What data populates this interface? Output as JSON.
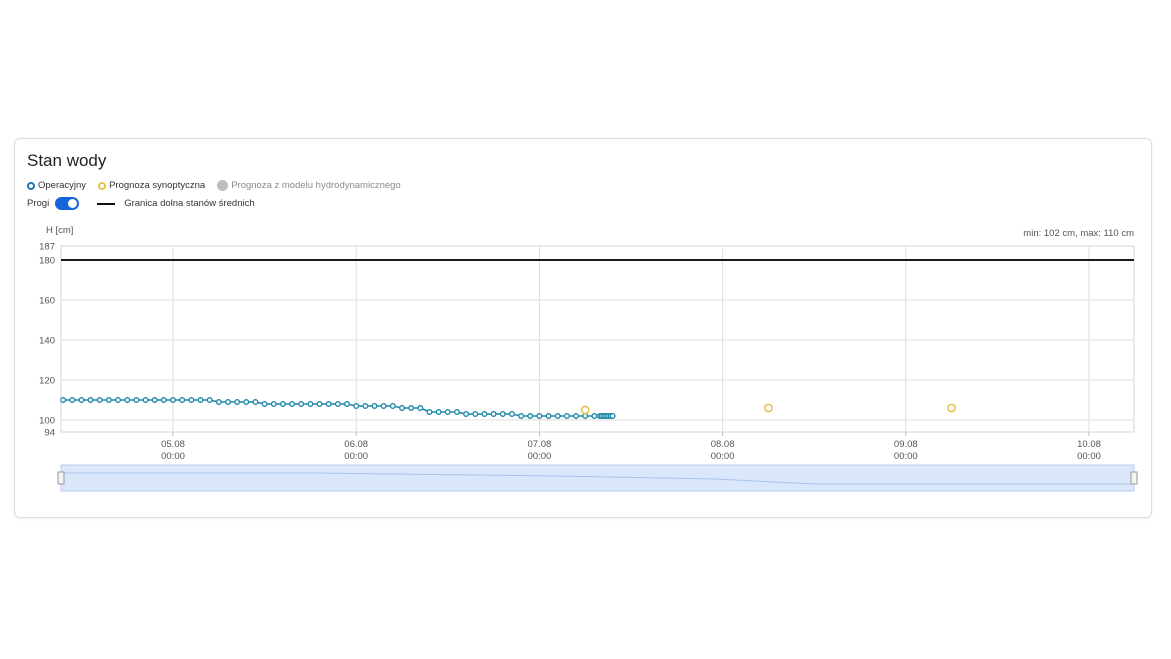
{
  "card": {
    "title": "Stan wody"
  },
  "legend": [
    {
      "label": "Operacyjny",
      "color": "#1f77b4",
      "style": "ring"
    },
    {
      "label": "Prognoza synoptyczna",
      "color": "#e3c34a",
      "style": "ring"
    },
    {
      "label": "Prognoza z modelu hydrodynamicznego",
      "color": "#bdbdbd",
      "style": "dot"
    }
  ],
  "thresholds": {
    "toggle_label": "Progi",
    "toggle_on": true,
    "toggle_color": "#1565d8",
    "line_label": "Granica dolna stanów średnich"
  },
  "chart_data": {
    "type": "line",
    "ylabel": "H [cm]",
    "minmax_label": "min: 102 cm, max: 110 cm",
    "ylim": [
      94,
      187
    ],
    "yticks": [
      94,
      100,
      120,
      140,
      160,
      180,
      187
    ],
    "x_days": [
      "05.08",
      "06.08",
      "07.08",
      "08.08",
      "09.08",
      "10.08"
    ],
    "x_time": "00:00",
    "threshold_value": 180,
    "series": [
      {
        "name": "Operacyjny",
        "color": "#1a86a8",
        "points": [
          [
            -0.6,
            110
          ],
          [
            -0.55,
            110
          ],
          [
            -0.5,
            110
          ],
          [
            -0.45,
            110
          ],
          [
            -0.4,
            110
          ],
          [
            -0.35,
            110
          ],
          [
            -0.3,
            110
          ],
          [
            -0.25,
            110
          ],
          [
            -0.2,
            110
          ],
          [
            -0.15,
            110
          ],
          [
            -0.1,
            110
          ],
          [
            -0.05,
            110
          ],
          [
            0,
            110
          ],
          [
            0.05,
            110
          ],
          [
            0.1,
            110
          ],
          [
            0.15,
            110
          ],
          [
            0.2,
            110
          ],
          [
            0.25,
            109
          ],
          [
            0.3,
            109
          ],
          [
            0.35,
            109
          ],
          [
            0.4,
            109
          ],
          [
            0.45,
            109
          ],
          [
            0.5,
            108
          ],
          [
            0.55,
            108
          ],
          [
            0.6,
            108
          ],
          [
            0.65,
            108
          ],
          [
            0.7,
            108
          ],
          [
            0.75,
            108
          ],
          [
            0.8,
            108
          ],
          [
            0.85,
            108
          ],
          [
            0.9,
            108
          ],
          [
            0.95,
            108
          ],
          [
            1,
            107
          ],
          [
            1.05,
            107
          ],
          [
            1.1,
            107
          ],
          [
            1.15,
            107
          ],
          [
            1.2,
            107
          ],
          [
            1.25,
            106
          ],
          [
            1.3,
            106
          ],
          [
            1.35,
            106
          ],
          [
            1.4,
            104
          ],
          [
            1.45,
            104
          ],
          [
            1.5,
            104
          ],
          [
            1.55,
            104
          ],
          [
            1.6,
            103
          ],
          [
            1.65,
            103
          ],
          [
            1.7,
            103
          ],
          [
            1.75,
            103
          ],
          [
            1.8,
            103
          ],
          [
            1.85,
            103
          ],
          [
            1.9,
            102
          ],
          [
            1.95,
            102
          ],
          [
            2,
            102
          ],
          [
            2.05,
            102
          ],
          [
            2.1,
            102
          ],
          [
            2.15,
            102
          ],
          [
            2.2,
            102
          ],
          [
            2.25,
            102
          ],
          [
            2.3,
            102
          ],
          [
            2.33,
            102
          ],
          [
            2.34,
            102
          ],
          [
            2.35,
            102
          ],
          [
            2.36,
            102
          ],
          [
            2.37,
            102
          ],
          [
            2.38,
            102
          ],
          [
            2.39,
            102
          ],
          [
            2.4,
            102
          ]
        ]
      },
      {
        "name": "Prognoza synoptyczna",
        "color": "#e3c34a",
        "points": [
          [
            2.25,
            105
          ],
          [
            3.25,
            106
          ],
          [
            4.25,
            106
          ]
        ]
      }
    ]
  },
  "navigator": {
    "fill": "#dbe8fb",
    "border": "#b8cdee"
  }
}
